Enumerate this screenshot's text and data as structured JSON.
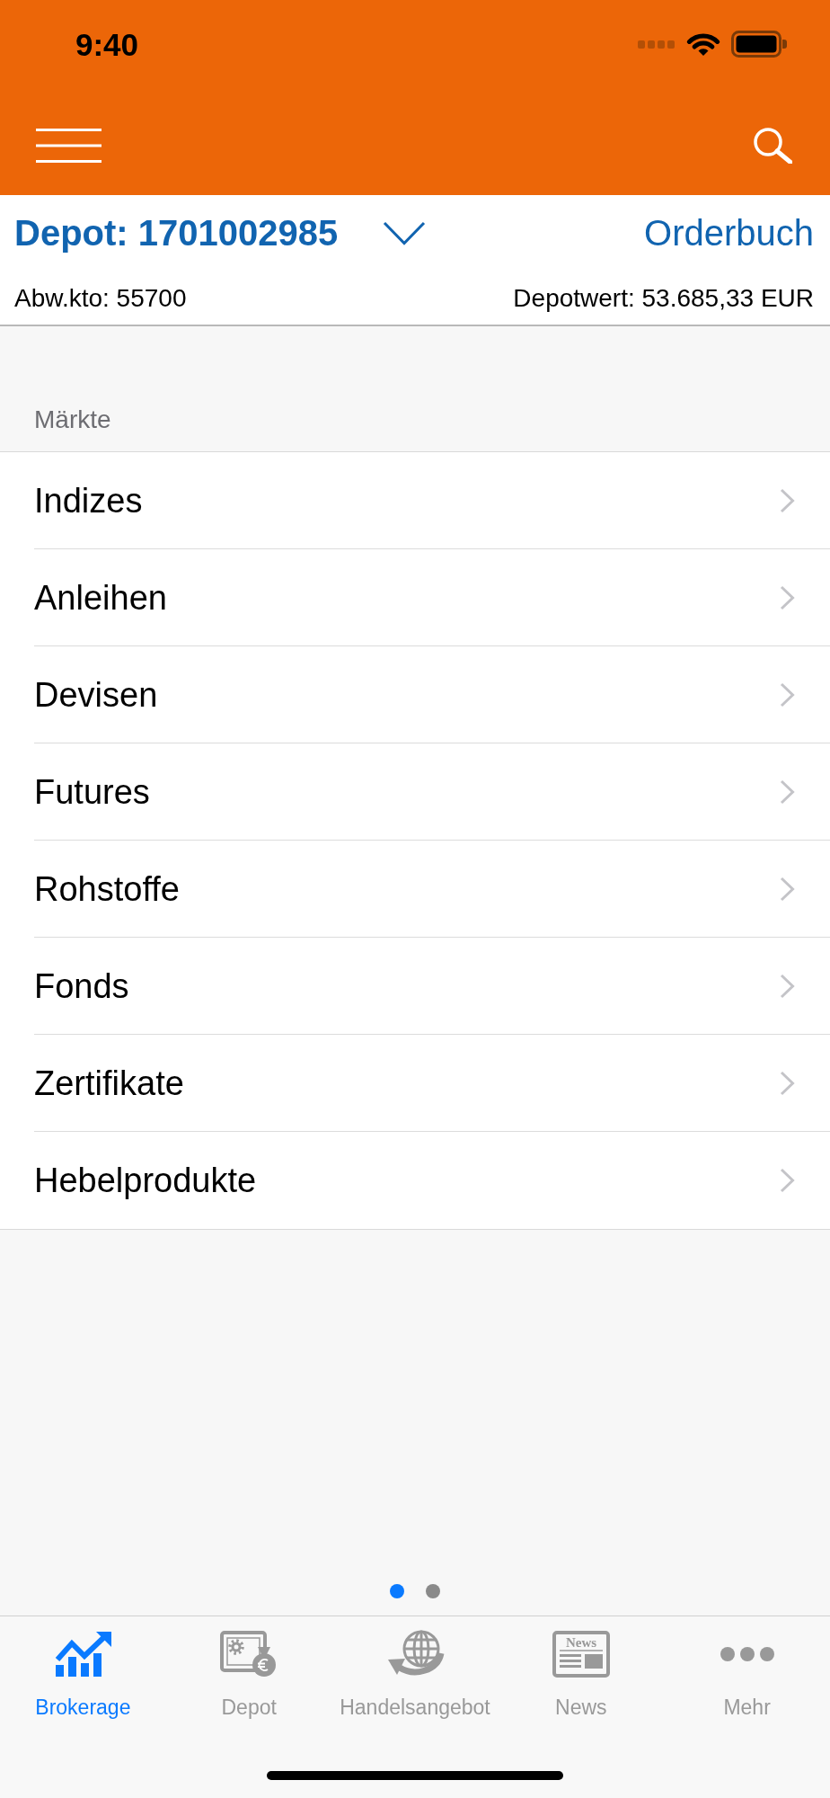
{
  "status_bar": {
    "time": "9:40"
  },
  "depot_bar": {
    "depot": "Depot: 1701002985",
    "orderbook": "Orderbuch",
    "account": "Abw.kto: 55700",
    "depot_value": "Depotwert: 53.685,33 EUR"
  },
  "markets": {
    "title": "Märkte",
    "items": [
      "Indizes",
      "Anleihen",
      "Devisen",
      "Futures",
      "Rohstoffe",
      "Fonds",
      "Zertifikate",
      "Hebelprodukte"
    ]
  },
  "page_indicator": [
    {
      "selected": true
    },
    {
      "selected": false
    }
  ],
  "tab_bar": [
    {
      "label": "Brokerage",
      "kind": "chart",
      "selected": true
    },
    {
      "label": "Depot",
      "kind": "safe",
      "selected": false
    },
    {
      "label": "Handelsangebot",
      "kind": "globe",
      "selected": false
    },
    {
      "label": "News",
      "kind": "newspaper",
      "icon_text": "News",
      "selected": false
    },
    {
      "label": "Mehr",
      "kind": "more",
      "selected": false
    }
  ]
}
